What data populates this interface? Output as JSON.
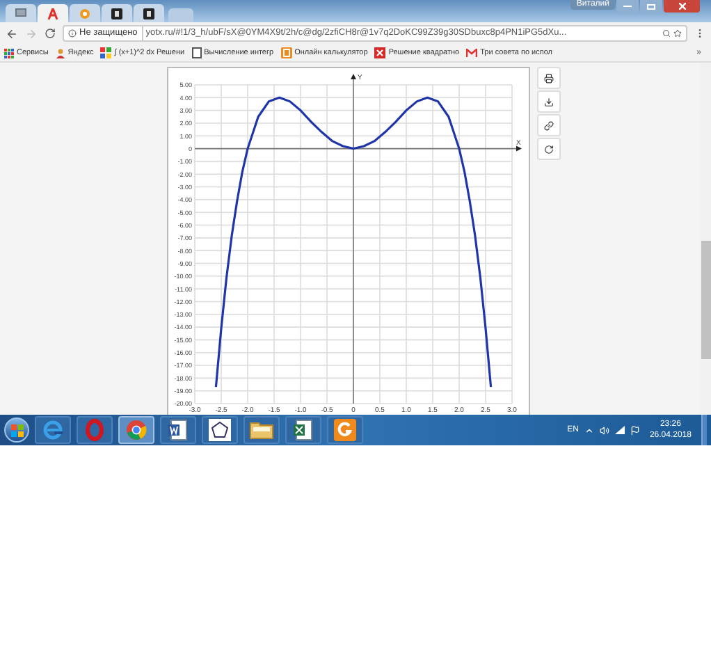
{
  "browser": {
    "user": "Виталий",
    "tabs": [
      {
        "kind": "monitor",
        "selected": false
      },
      {
        "kind": "letter",
        "selected": true
      },
      {
        "kind": "sun",
        "selected": false
      },
      {
        "kind": "dark",
        "selected": false
      },
      {
        "kind": "dark",
        "selected": false
      }
    ],
    "back": {
      "disabled": false
    },
    "forward": {
      "disabled": true
    },
    "security": "Не защищено",
    "url": "yotx.ru/#!1/3_h/ubF/sX@0YM4X9t/2h/c@dg/2zfiCH8r@1v7q2DoKC99Z39g30SDbuxc8p4PN1iPG5dXu...",
    "bookmarks": [
      {
        "kind": "apps",
        "label": "Сервисы"
      },
      {
        "kind": "yandex",
        "label": "Яндекс"
      },
      {
        "kind": "tiles",
        "label": "∫ (x+1)^2 dx Решени"
      },
      {
        "kind": "page",
        "label": "Вычисление интегр"
      },
      {
        "kind": "orange",
        "label": "Онлайн калькулятор"
      },
      {
        "kind": "red",
        "label": "Решение квадратно"
      },
      {
        "kind": "gmail",
        "label": "Три совета по испол"
      }
    ],
    "bookmarks_more": "»"
  },
  "graph": {
    "chart_data": {
      "type": "line",
      "xlabel": "X",
      "ylabel": "Y",
      "xlim": [
        -3,
        3
      ],
      "ylim": [
        -20,
        5
      ],
      "grid": true,
      "x": [
        -2.6,
        -2.5,
        -2.4,
        -2.3,
        -2.2,
        -2.1,
        -2.0,
        -1.8,
        -1.6,
        -1.4,
        -1.2,
        -1.0,
        -0.8,
        -0.6,
        -0.4,
        -0.2,
        0,
        0.2,
        0.4,
        0.6,
        0.8,
        1.0,
        1.2,
        1.4,
        1.6,
        1.8,
        2.0,
        2.1,
        2.2,
        2.3,
        2.4,
        2.5,
        2.6
      ],
      "series": [
        {
          "color": "#1f35a8",
          "values": [
            -18.7,
            -14.1,
            -10.1,
            -6.8,
            -4.1,
            -1.8,
            0,
            2.5,
            3.7,
            4.0,
            3.7,
            3,
            2.1,
            1.3,
            0.6,
            0.2,
            0,
            0.2,
            0.6,
            1.3,
            2.1,
            3,
            3.7,
            4.0,
            3.7,
            2.5,
            0,
            -1.8,
            -4.1,
            -6.8,
            -10.1,
            -14.1,
            -18.7
          ]
        }
      ],
      "xticks": [
        {
          "value": -3,
          "label": "-3.0"
        },
        {
          "value": -2.5,
          "label": "-2.5"
        },
        {
          "value": -2,
          "label": "-2.0"
        },
        {
          "value": -1.5,
          "label": "-1.5"
        },
        {
          "value": -1,
          "label": "-1.0"
        },
        {
          "value": -0.5,
          "label": "-0.5"
        },
        {
          "value": 0,
          "label": "0"
        },
        {
          "value": 0.5,
          "label": "0.5"
        },
        {
          "value": 1,
          "label": "1.0"
        },
        {
          "value": 1.5,
          "label": "1.5"
        },
        {
          "value": 2,
          "label": "2.0"
        },
        {
          "value": 2.5,
          "label": "2.5"
        },
        {
          "value": 3,
          "label": "3.0"
        }
      ],
      "yticks": [
        {
          "value": 5,
          "label": "5.00"
        },
        {
          "value": 4,
          "label": "4.00"
        },
        {
          "value": 3,
          "label": "3.00"
        },
        {
          "value": 2,
          "label": "2.00"
        },
        {
          "value": 1,
          "label": "1.00"
        },
        {
          "value": 0,
          "label": "0"
        },
        {
          "value": -1,
          "label": "-1.00"
        },
        {
          "value": -2,
          "label": "-2.00"
        },
        {
          "value": -3,
          "label": "-3.00"
        },
        {
          "value": -4,
          "label": "-4.00"
        },
        {
          "value": -5,
          "label": "-5.00"
        },
        {
          "value": -6,
          "label": "-6.00"
        },
        {
          "value": -7,
          "label": "-7.00"
        },
        {
          "value": -8,
          "label": "-8.00"
        },
        {
          "value": -9,
          "label": "-9.00"
        },
        {
          "value": -10,
          "label": "-10.00"
        },
        {
          "value": -11,
          "label": "-11.00"
        },
        {
          "value": -12,
          "label": "-12.00"
        },
        {
          "value": -13,
          "label": "-13.00"
        },
        {
          "value": -14,
          "label": "-14.00"
        },
        {
          "value": -15,
          "label": "-15.00"
        },
        {
          "value": -16,
          "label": "-16.00"
        },
        {
          "value": -17,
          "label": "-17.00"
        },
        {
          "value": -18,
          "label": "-18.00"
        },
        {
          "value": -19,
          "label": "-19.00"
        },
        {
          "value": -20,
          "label": "-20.00"
        }
      ]
    }
  },
  "taskbar": {
    "apps": [
      {
        "kind": "ie",
        "selected": false
      },
      {
        "kind": "opera",
        "selected": false
      },
      {
        "kind": "chrome",
        "selected": true
      },
      {
        "kind": "word",
        "selected": false
      },
      {
        "kind": "pentagon",
        "selected": false
      },
      {
        "kind": "folder",
        "selected": false
      },
      {
        "kind": "excel",
        "selected": false
      },
      {
        "kind": "orange",
        "selected": false
      }
    ],
    "language": "EN",
    "time": "23:26",
    "date": "26.04.2018"
  }
}
